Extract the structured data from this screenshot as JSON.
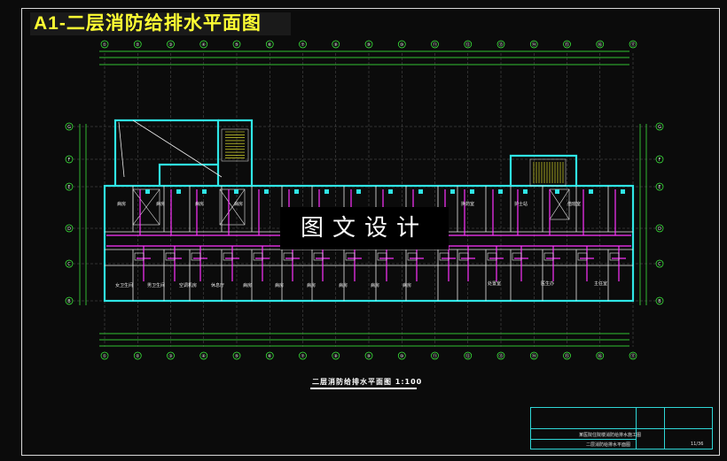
{
  "header": {
    "title": "A1-二层消防给排水平面图"
  },
  "watermark": {
    "text": "图文设计"
  },
  "drawing": {
    "caption": "二层消防给排水平面图 1:100",
    "grid_numbers_top": [
      "①",
      "②",
      "③",
      "④",
      "⑤",
      "⑥",
      "⑦",
      "⑧",
      "⑨",
      "⑩",
      "⑪",
      "⑫",
      "⑬",
      "⑭",
      "⑮",
      "⑯",
      "⑰"
    ],
    "grid_numbers_bottom": [
      "①",
      "②",
      "③",
      "④",
      "⑤",
      "⑥",
      "⑦",
      "⑧",
      "⑨",
      "⑩",
      "⑪",
      "⑫",
      "⑬",
      "⑭",
      "⑮",
      "⑯",
      "⑰"
    ],
    "grid_letters_left": [
      "G",
      "F",
      "E",
      "D",
      "C",
      "B"
    ],
    "grid_letters_right": [
      "G",
      "F",
      "E",
      "D",
      "C",
      "B"
    ],
    "room_labels": [
      "女卫生间",
      "男卫生间",
      "空调机房",
      "休息厅",
      "病房",
      "病房",
      "病房",
      "病房",
      "病房",
      "病房",
      "病房",
      "病房",
      "病房",
      "病房",
      "换药室",
      "处置室",
      "护士站",
      "医生办",
      "值班室",
      "主任室"
    ],
    "colors": {
      "wall": "#2fe6e6",
      "pipe": "#ff33ff",
      "dimension": "#40ff40",
      "line": "#e8e8e8",
      "title": "#ffff33"
    }
  },
  "title_block": {
    "project": "某医院住院楼消防给排水施工图",
    "drawing_name": "二层消防给排水平面图",
    "sheet": "11/36"
  }
}
